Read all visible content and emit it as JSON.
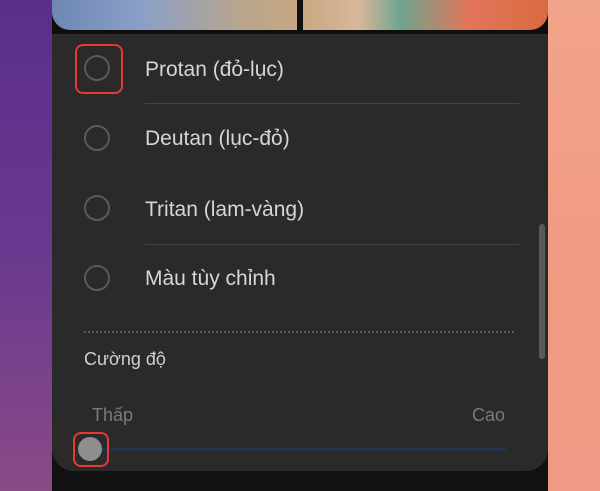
{
  "color_filter": {
    "options": [
      {
        "label": "Protan (đỏ-lục)",
        "selected": false,
        "highlighted": true
      },
      {
        "label": "Deutan (lục-đỏ)",
        "selected": false,
        "highlighted": false
      },
      {
        "label": "Tritan (lam-vàng)",
        "selected": false,
        "highlighted": false
      },
      {
        "label": "Màu tùy chỉnh",
        "selected": false,
        "highlighted": false
      }
    ],
    "intensity": {
      "title": "Cường độ",
      "low_label": "Thấp",
      "high_label": "Cao",
      "value": 0,
      "thumb_highlighted": true
    }
  },
  "colors": {
    "panel": "#2a2a2a",
    "highlight": "#e53935",
    "text": "#d6d6d6"
  }
}
